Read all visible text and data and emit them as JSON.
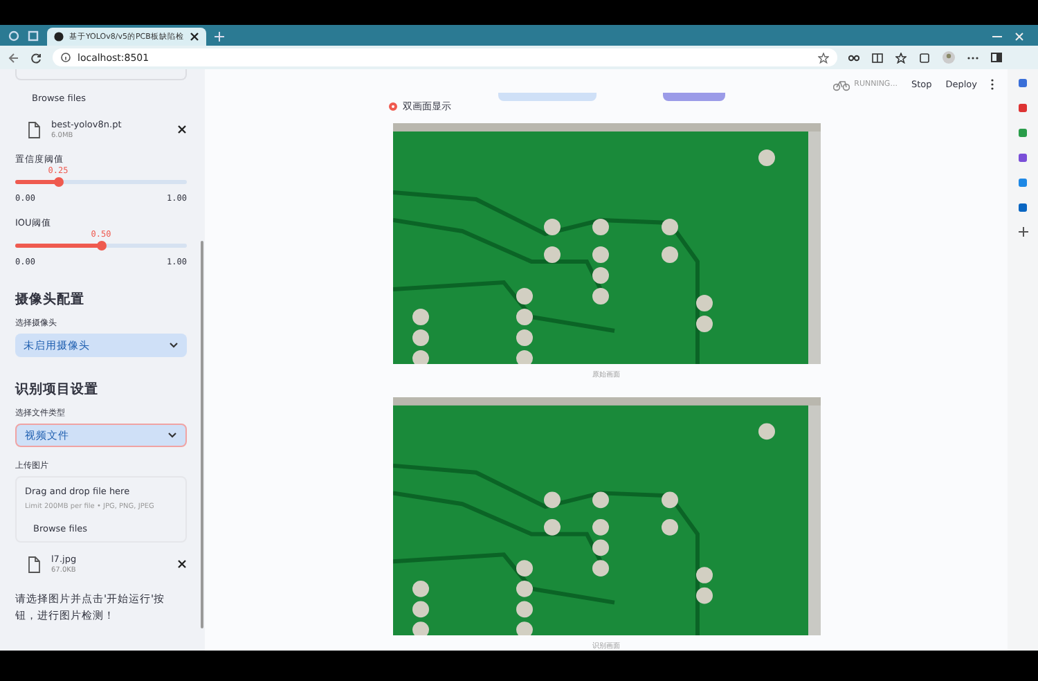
{
  "browser": {
    "tab_title": "基于YOLOv8/v5的PCB板缺陷检",
    "address": "localhost:8501"
  },
  "header": {
    "status": "RUNNING...",
    "buttons": [
      "Stop",
      "Deploy"
    ]
  },
  "sidebar": {
    "top_button": "Browse files",
    "model_file": {
      "name": "best-yolov8n.pt",
      "size": "6.0MB"
    },
    "sliders": [
      {
        "label": "置信度阈值",
        "value": "0.25",
        "level": 0.25,
        "min": "0.00",
        "max": "1.00"
      },
      {
        "label": "IOU阈值",
        "value": "0.50",
        "level": 0.5,
        "min": "0.00",
        "max": "1.00"
      }
    ],
    "camera": {
      "heading": "摄像头配置",
      "label": "选择摄像头",
      "value": "未启用摄像头"
    },
    "recognition": {
      "heading": "识别项目设置",
      "label": "选择文件类型",
      "value": "视频文件",
      "upload_label": "上传图片",
      "drop_text": "Drag and drop file here",
      "limit": "Limit 200MB per file • JPG, PNG, JPEG",
      "browse": "Browse files",
      "file": {
        "name": "l7.jpg",
        "size": "67.0KB"
      }
    },
    "message": "请选择图片并点击'开始运行'按钮，进行图片检测！"
  },
  "main": {
    "radio": {
      "label": "双画面显示",
      "selected": true
    },
    "images": [
      {
        "caption": "原始画面"
      },
      {
        "caption": "识别画面"
      }
    ]
  }
}
